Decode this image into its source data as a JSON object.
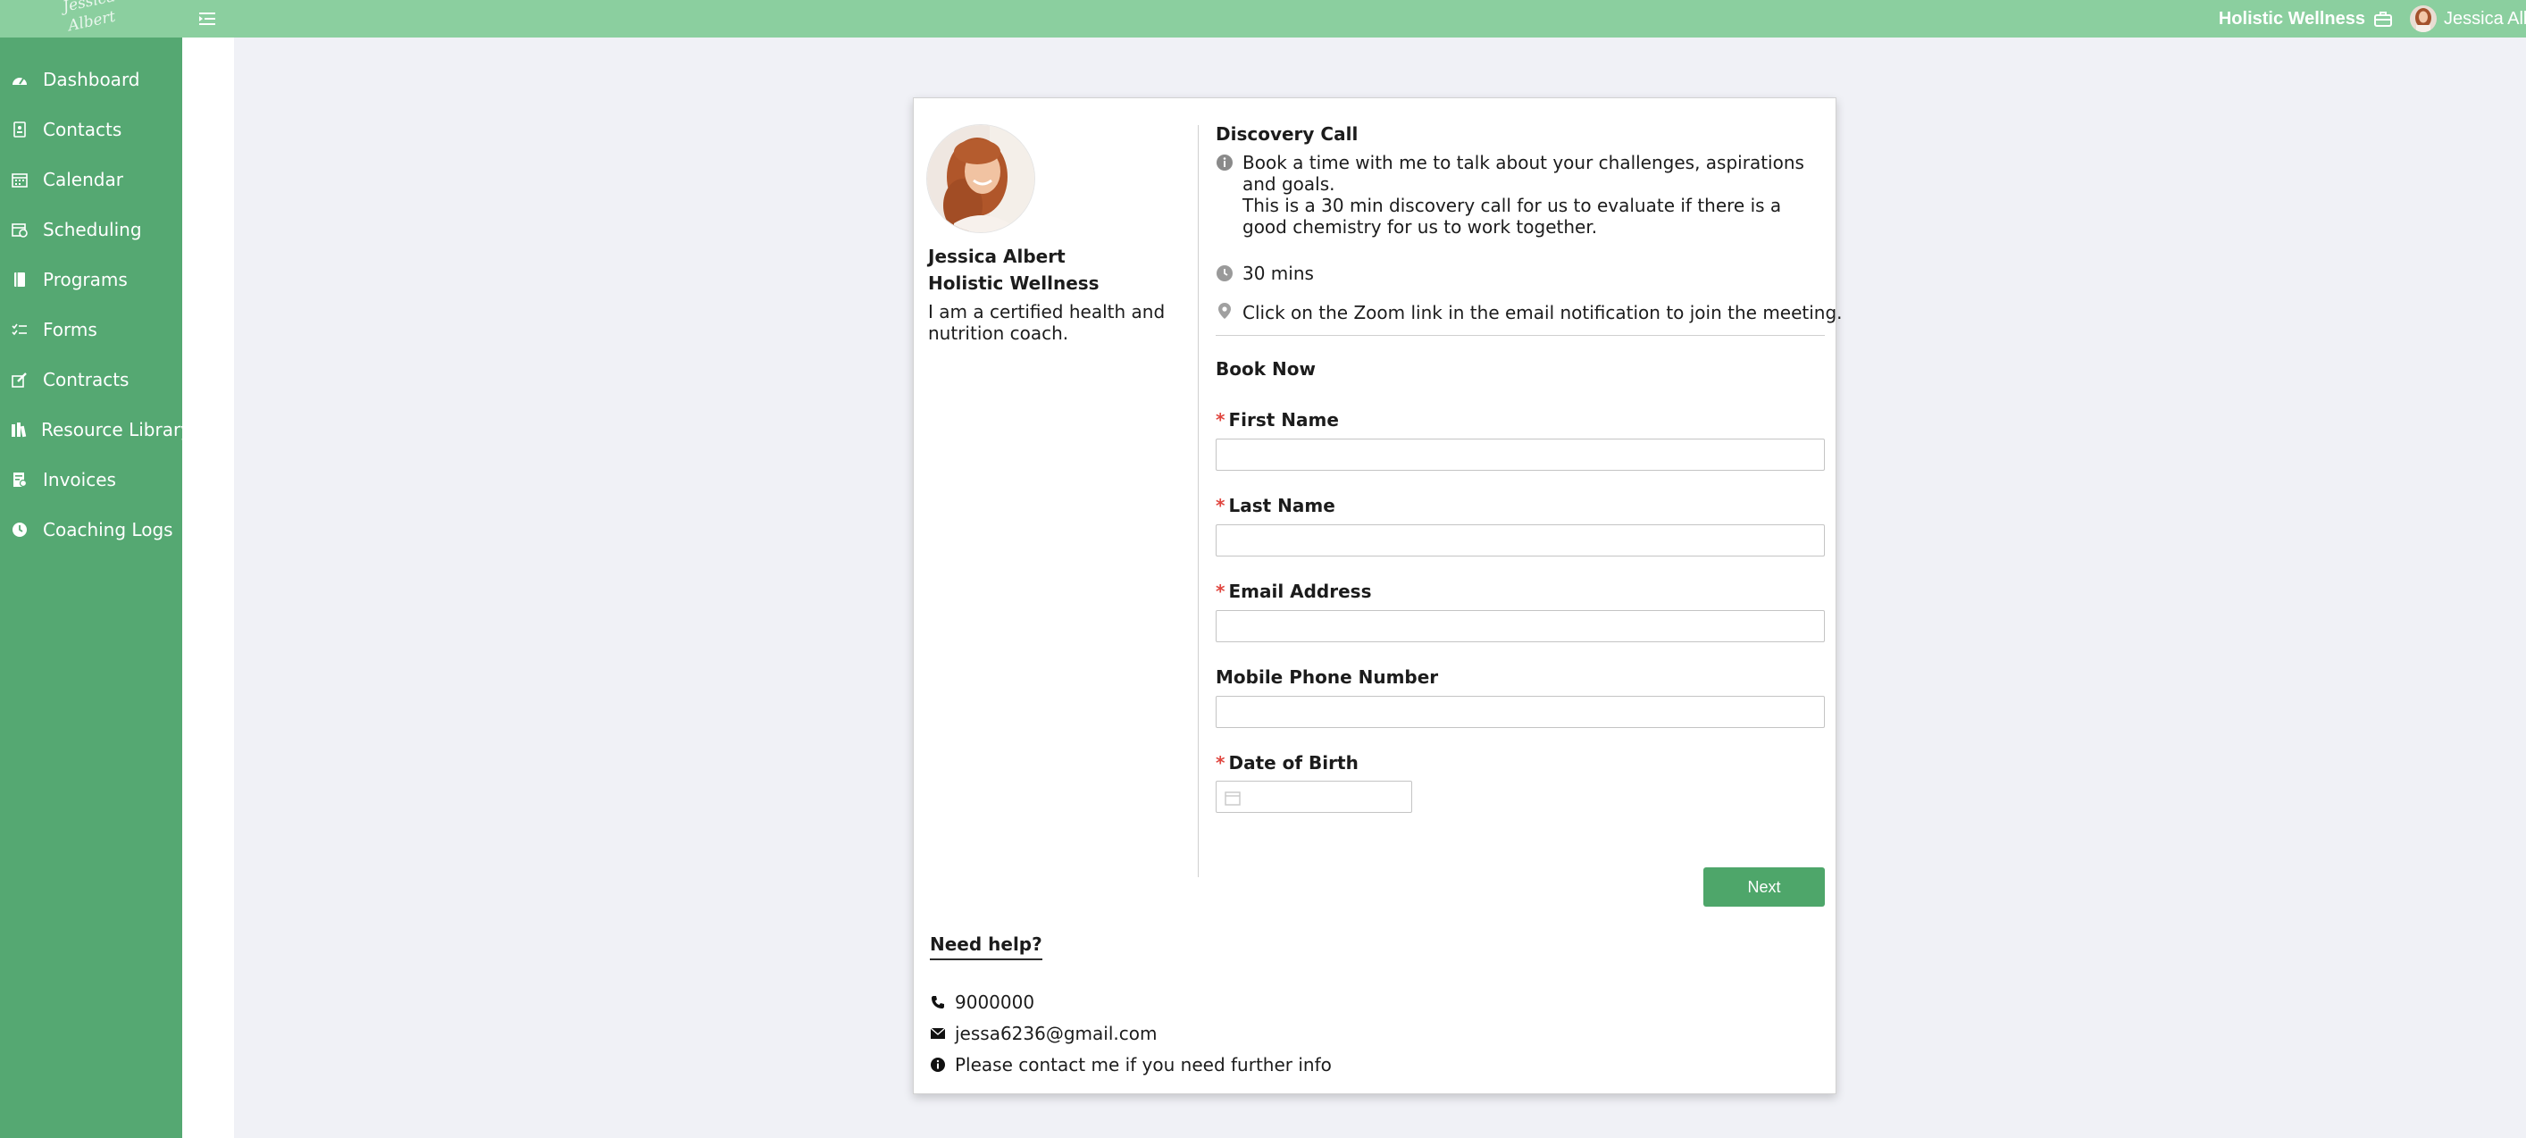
{
  "app": {
    "logo_line1": "Jessica",
    "logo_line2": "Albert",
    "business_name": "Holistic Wellness",
    "user_name": "Jessica Albert"
  },
  "sidebar": {
    "items": [
      {
        "label": "Dashboard",
        "icon": "dashboard-icon"
      },
      {
        "label": "Contacts",
        "icon": "contacts-icon"
      },
      {
        "label": "Calendar",
        "icon": "calendar-icon"
      },
      {
        "label": "Scheduling",
        "icon": "scheduling-icon"
      },
      {
        "label": "Programs",
        "icon": "programs-icon"
      },
      {
        "label": "Forms",
        "icon": "forms-icon"
      },
      {
        "label": "Contracts",
        "icon": "contracts-icon"
      },
      {
        "label": "Resource Library",
        "icon": "resource-library-icon"
      },
      {
        "label": "Invoices",
        "icon": "invoices-icon"
      },
      {
        "label": "Coaching Logs",
        "icon": "coaching-logs-icon"
      }
    ]
  },
  "profile": {
    "name": "Jessica Albert",
    "business": "Holistic Wellness",
    "bio": "I am a certified health and nutrition coach."
  },
  "event": {
    "title": "Discovery Call",
    "description_line1": "Book a time with me to talk about your challenges, aspirations and goals.",
    "description_line2": "This is a 30 min discovery call for us to evaluate if there is a good chemistry for us to work together.",
    "duration": "30 mins",
    "location": "Click on the Zoom link in the email notification to join the meeting."
  },
  "form": {
    "heading": "Book Now",
    "required_mark": "*",
    "fields": {
      "first_name": "First Name",
      "last_name": "Last Name",
      "email": "Email Address",
      "phone": "Mobile Phone Number",
      "dob": "Date of Birth"
    },
    "next_label": "Next"
  },
  "help": {
    "title": "Need help?",
    "phone": "9000000",
    "email": "jessa6236@gmail.com",
    "info": "Please contact me if you need further info"
  },
  "colors": {
    "topbar": "#8bcf9f",
    "sidebar": "#55a872",
    "accent_button": "#4ea66a",
    "required": "#e0463f"
  }
}
